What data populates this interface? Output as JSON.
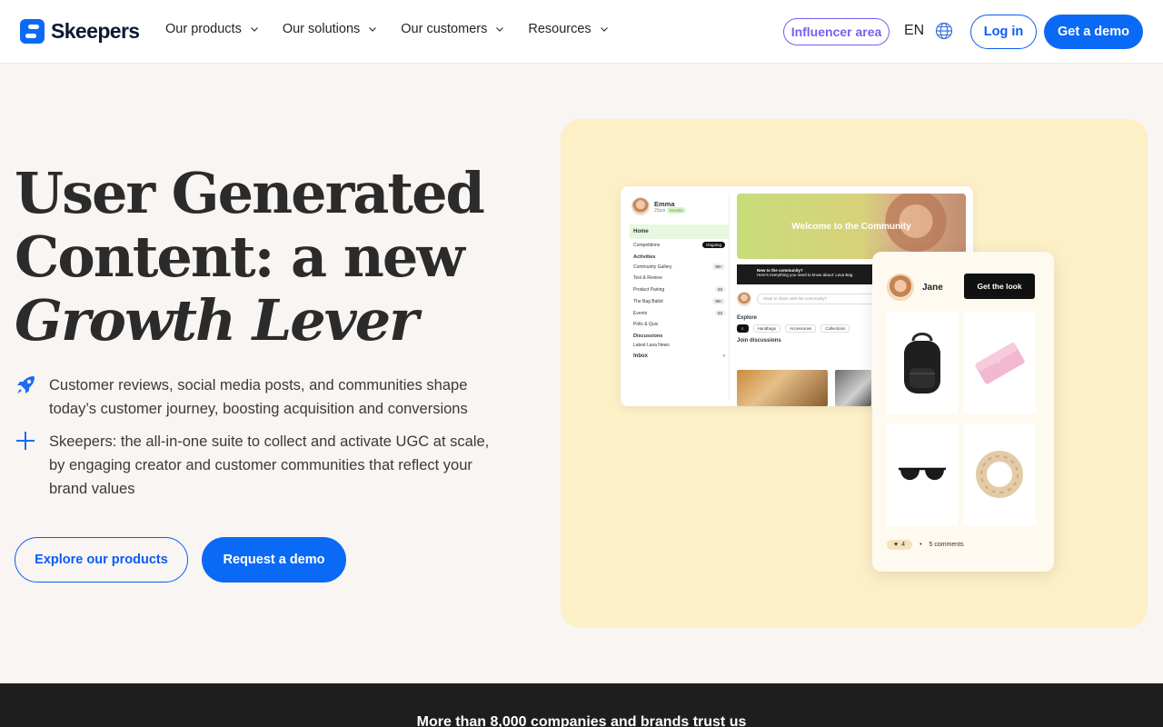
{
  "brand": {
    "name": "Skeepers",
    "primary": "#0b6af5",
    "influencer_color": "#7b5cf0"
  },
  "nav": {
    "menu": [
      {
        "label": "Our products"
      },
      {
        "label": "Our solutions"
      },
      {
        "label": "Our customers"
      },
      {
        "label": "Resources"
      }
    ],
    "influencer_label": "Influencer area",
    "language": "EN",
    "login_label": "Log in",
    "demo_label": "Get a demo"
  },
  "hero": {
    "title_line1": "User Generated",
    "title_line2": "Content: a new",
    "title_line3": "Growth Lever",
    "feature1": "Customer reviews, social media posts, and communities shape today’s customer journey, boosting acquisition and conversions",
    "feature2": "Skeepers: the all-in-one suite to collect and activate UGC at scale, by engaging creator and customer communities that reflect your brand values",
    "feature_icons": [
      "rocket-icon",
      "plus-icon"
    ],
    "explore_label": "Explore our products",
    "request_label": "Request a demo"
  },
  "illustration": {
    "community": {
      "user_name": "Emma",
      "user_points": "20pts",
      "user_badge": "Newbie",
      "home": "Home",
      "competitions": "Competitions",
      "competitions_badge": "Ongoing",
      "activities": "Activities",
      "items": [
        {
          "label": "Community Gallery",
          "count": "99+"
        },
        {
          "label": "Test & Review",
          "count": ""
        },
        {
          "label": "Product Pairing",
          "count": "93"
        },
        {
          "label": "The Bag Ballot",
          "count": "99+"
        },
        {
          "label": "Events",
          "count": "53"
        },
        {
          "label": "Polls & Quiz",
          "count": ""
        }
      ],
      "discussions": "Discussions",
      "latest": "Latest Lava News",
      "inbox": "Inbox",
      "welcome": "Welcome to the Community",
      "strip_title": "New to the community?",
      "strip_text": "Here's everything you need to know about: Lava Bag",
      "ask_placeholder": "Want to share with the community?",
      "explore": "Explore",
      "chips": [
        "Handbags",
        "Accessories",
        "Collections"
      ],
      "join": "Join discussions"
    },
    "product_card": {
      "user_name": "Jane",
      "cta": "Get the look",
      "products": [
        "backpack-icon",
        "wallet-icon",
        "sunglasses-icon",
        "scrunchie-icon"
      ],
      "likes": "4",
      "comments": "5 comments"
    }
  },
  "band": {
    "text": "More than 8,000 companies and brands trust us"
  }
}
